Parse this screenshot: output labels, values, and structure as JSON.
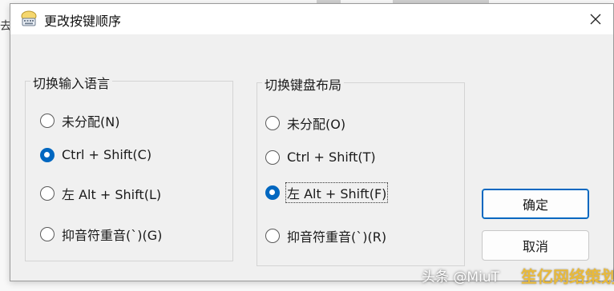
{
  "background": {
    "left_char": "去"
  },
  "dialog": {
    "title": "更改按键顺序",
    "close_icon": "close-icon"
  },
  "input_language_group": {
    "legend": "切换输入语言",
    "options": [
      {
        "label": "未分配(N)",
        "checked": false
      },
      {
        "label": "Ctrl + Shift(C)",
        "checked": true
      },
      {
        "label": "左 Alt + Shift(L)",
        "checked": false
      },
      {
        "label": "抑音符重音(`)(G)",
        "checked": false
      }
    ]
  },
  "keyboard_layout_group": {
    "legend": "切换键盘布局",
    "options": [
      {
        "label": "未分配(O)",
        "checked": false
      },
      {
        "label": "Ctrl + Shift(T)",
        "checked": false
      },
      {
        "label": "左 Alt + Shift(F)",
        "checked": true
      },
      {
        "label": "抑音符重音(`)(R)",
        "checked": false
      }
    ]
  },
  "buttons": {
    "ok": "确定",
    "cancel": "取消"
  },
  "watermark": {
    "text": "头条 @MiuT",
    "logo_text": "笙亿网络策划"
  },
  "colors": {
    "accent": "#0067c0",
    "dialog_bg": "#f0f0f0",
    "titlebar_bg": "#ffffff"
  }
}
